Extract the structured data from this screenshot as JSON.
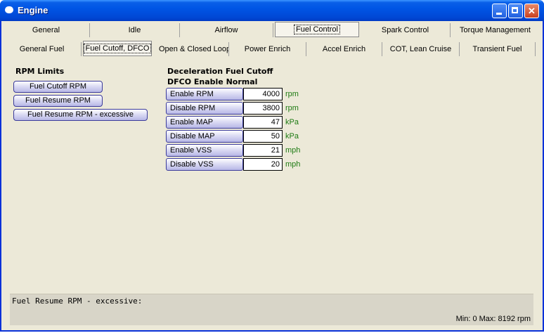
{
  "window": {
    "title": "Engine",
    "icon": "engine-icon"
  },
  "main_tabs": [
    "General",
    "Idle",
    "Airflow",
    "Fuel Control",
    "Spark Control",
    "Torque Management"
  ],
  "main_tab_selected": "Fuel Control",
  "sub_tabs": [
    "General Fuel",
    "Fuel Cutoff, DFCO",
    "Open & Closed Loop",
    "Power Enrich",
    "Accel Enrich",
    "COT, Lean Cruise",
    "Transient Fuel"
  ],
  "sub_tab_selected": "Fuel Cutoff, DFCO",
  "rpm_limits": {
    "heading": "RPM Limits",
    "buttons": [
      "Fuel Cutoff RPM",
      "Fuel Resume RPM",
      "Fuel Resume RPM - excessive"
    ]
  },
  "dfco": {
    "heading": "Deceleration Fuel Cutoff",
    "subheading": "DFCO Enable Normal",
    "rows": [
      {
        "label": "Enable RPM",
        "value": "4000",
        "unit": "rpm"
      },
      {
        "label": "Disable RPM",
        "value": "3800",
        "unit": "rpm"
      },
      {
        "label": "Enable MAP",
        "value": "47",
        "unit": "kPa"
      },
      {
        "label": "Disable MAP",
        "value": "50",
        "unit": "kPa"
      },
      {
        "label": "Enable VSS",
        "value": "21",
        "unit": "mph"
      },
      {
        "label": "Disable VSS",
        "value": "20",
        "unit": "mph"
      }
    ]
  },
  "status": {
    "description": "Fuel Resume RPM - excessive:",
    "range": "Min: 0 Max: 8192 rpm"
  },
  "colors": {
    "title_bar": "#0055e5",
    "unit_text": "#1d7a12",
    "panel": "#ece9d8"
  }
}
